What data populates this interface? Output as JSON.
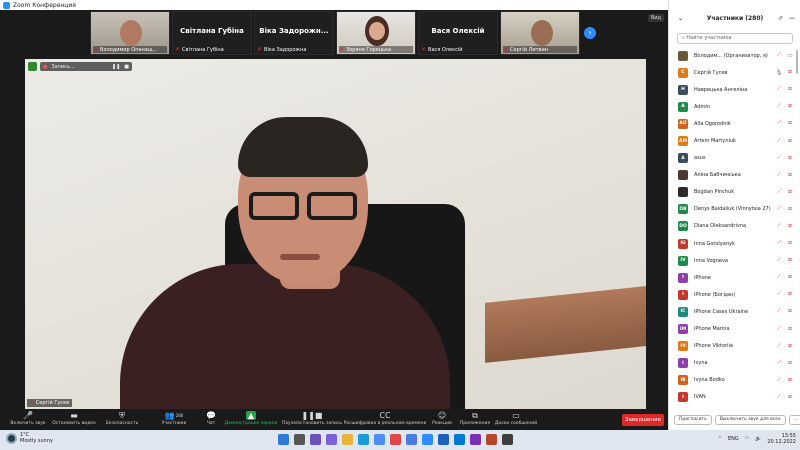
{
  "window": {
    "title": "Zoom Конференция"
  },
  "colors": {
    "accent": "#2d8cff",
    "end_red": "#e02828",
    "muted_red": "#e02828",
    "share_green": "#22a34a"
  },
  "thumbnails": [
    {
      "name": "Володимир Опанащ...",
      "center_name": "",
      "video": true
    },
    {
      "name": "Світлана Губіна",
      "center_name": "Світлана Губіна",
      "video": false
    },
    {
      "name": "Віка Задорожна",
      "center_name": "Віка Задорожн...",
      "video": false
    },
    {
      "name": "Зоряна Горецька",
      "center_name": "",
      "video": true
    },
    {
      "name": "Вася Олексій",
      "center_name": "Вася Олексій",
      "video": false
    },
    {
      "name": "Сергій Литвин",
      "center_name": "",
      "video": true
    }
  ],
  "view_button": "Вид",
  "main_video": {
    "speaker": "Сергій Гусев",
    "recording_label": "Запись..."
  },
  "toolbar": {
    "items": [
      {
        "icon": "microphone-icon",
        "label": "Включить звук"
      },
      {
        "icon": "video-icon",
        "label": "Остановить видео"
      },
      {
        "icon": "shield-icon",
        "label": "Безопасность"
      },
      {
        "icon": "participants-icon",
        "label": "Участники",
        "count": "280"
      },
      {
        "icon": "chat-icon",
        "label": "Чат"
      },
      {
        "icon": "share-screen-icon",
        "label": "Демонстрация экрана"
      },
      {
        "icon": "pause-record-icon",
        "label": "Пауза/остановить запись"
      },
      {
        "icon": "captions-icon",
        "label": "Расшифровка в реальном времени"
      },
      {
        "icon": "reactions-icon",
        "label": "Реакции"
      },
      {
        "icon": "apps-icon",
        "label": "Приложения"
      },
      {
        "icon": "whiteboard-icon",
        "label": "Доски сообщений"
      }
    ],
    "end_button": "Завершение"
  },
  "panel": {
    "title": "Участники (280)",
    "search_placeholder": "Найти участника",
    "participants": [
      {
        "initials": "",
        "name": "Володим... (Организатор, я)",
        "color": "#6b5a3a",
        "mic": "muted",
        "cam": "on"
      },
      {
        "initials": "С",
        "name": "Сергій Гусев",
        "color": "#e07b1a",
        "mic": "on",
        "cam": "off"
      },
      {
        "initials": "Н",
        "name": "Наврецька Ангеліна",
        "color": "#3a4d5c",
        "mic": "muted",
        "cam": "off"
      },
      {
        "initials": "A",
        "name": "Admin",
        "color": "#1f8a4c",
        "mic": "muted",
        "cam": "off"
      },
      {
        "initials": "AO",
        "name": "Alla Ogorodnik",
        "color": "#d0621a",
        "mic": "muted",
        "cam": "off"
      },
      {
        "initials": "AM",
        "name": "Artem Martyniuk",
        "color": "#e07b1a",
        "mic": "muted",
        "cam": "off"
      },
      {
        "initials": "A",
        "name": "asus",
        "color": "#3a4d5c",
        "mic": "muted",
        "cam": "off"
      },
      {
        "initials": "",
        "name": "Аліна Бабчинська",
        "color": "#4a3a33",
        "mic": "muted",
        "cam": "off"
      },
      {
        "initials": "",
        "name": "Bogdan Pinchuk",
        "color": "#2b2b2b",
        "mic": "muted",
        "cam": "off"
      },
      {
        "initials": "DB",
        "name": "Denys Baidaliuk (Vinnytsia 27)",
        "color": "#1f8a4c",
        "mic": "muted",
        "cam": "off"
      },
      {
        "initials": "DO",
        "name": "Diana Oleksandrivna",
        "color": "#1f8a4c",
        "mic": "muted",
        "cam": "off"
      },
      {
        "initials": "IG",
        "name": "Inna Gorolyanyk",
        "color": "#c0392b",
        "mic": "muted",
        "cam": "off"
      },
      {
        "initials": "IV",
        "name": "Inna Vogneva",
        "color": "#1f8a4c",
        "mic": "muted",
        "cam": "off"
      },
      {
        "initials": "I",
        "name": "iPhone",
        "color": "#8e3fa8",
        "mic": "muted",
        "cam": "off"
      },
      {
        "initials": "I",
        "name": "iPhone (Богдан)",
        "color": "#c0392b",
        "mic": "muted",
        "cam": "off"
      },
      {
        "initials": "IC",
        "name": "iPhone Cases Ukraine",
        "color": "#1f8a7a",
        "mic": "muted",
        "cam": "off"
      },
      {
        "initials": "IM",
        "name": "iPhone Marina",
        "color": "#8e3fa8",
        "mic": "muted",
        "cam": "off"
      },
      {
        "initials": "IV",
        "name": "iPhone Viktoriia",
        "color": "#e07b1a",
        "mic": "muted",
        "cam": "off"
      },
      {
        "initials": "I",
        "name": "Ivyna",
        "color": "#8e3fa8",
        "mic": "muted",
        "cam": "off"
      },
      {
        "initials": "IB",
        "name": "Ivyna Bodko",
        "color": "#d0621a",
        "mic": "muted",
        "cam": "off"
      },
      {
        "initials": "I",
        "name": "IVAN",
        "color": "#c0392b",
        "mic": "muted",
        "cam": "off"
      }
    ],
    "invite_button": "Пригласить",
    "mute_all_button": "Выключить звук для всех",
    "more_button": "..."
  },
  "taskbar": {
    "weather_temp": "1°C",
    "weather_desc": "Mostly sunny",
    "lang": "ENG",
    "time": "13:55",
    "date": "20.12.2022"
  }
}
